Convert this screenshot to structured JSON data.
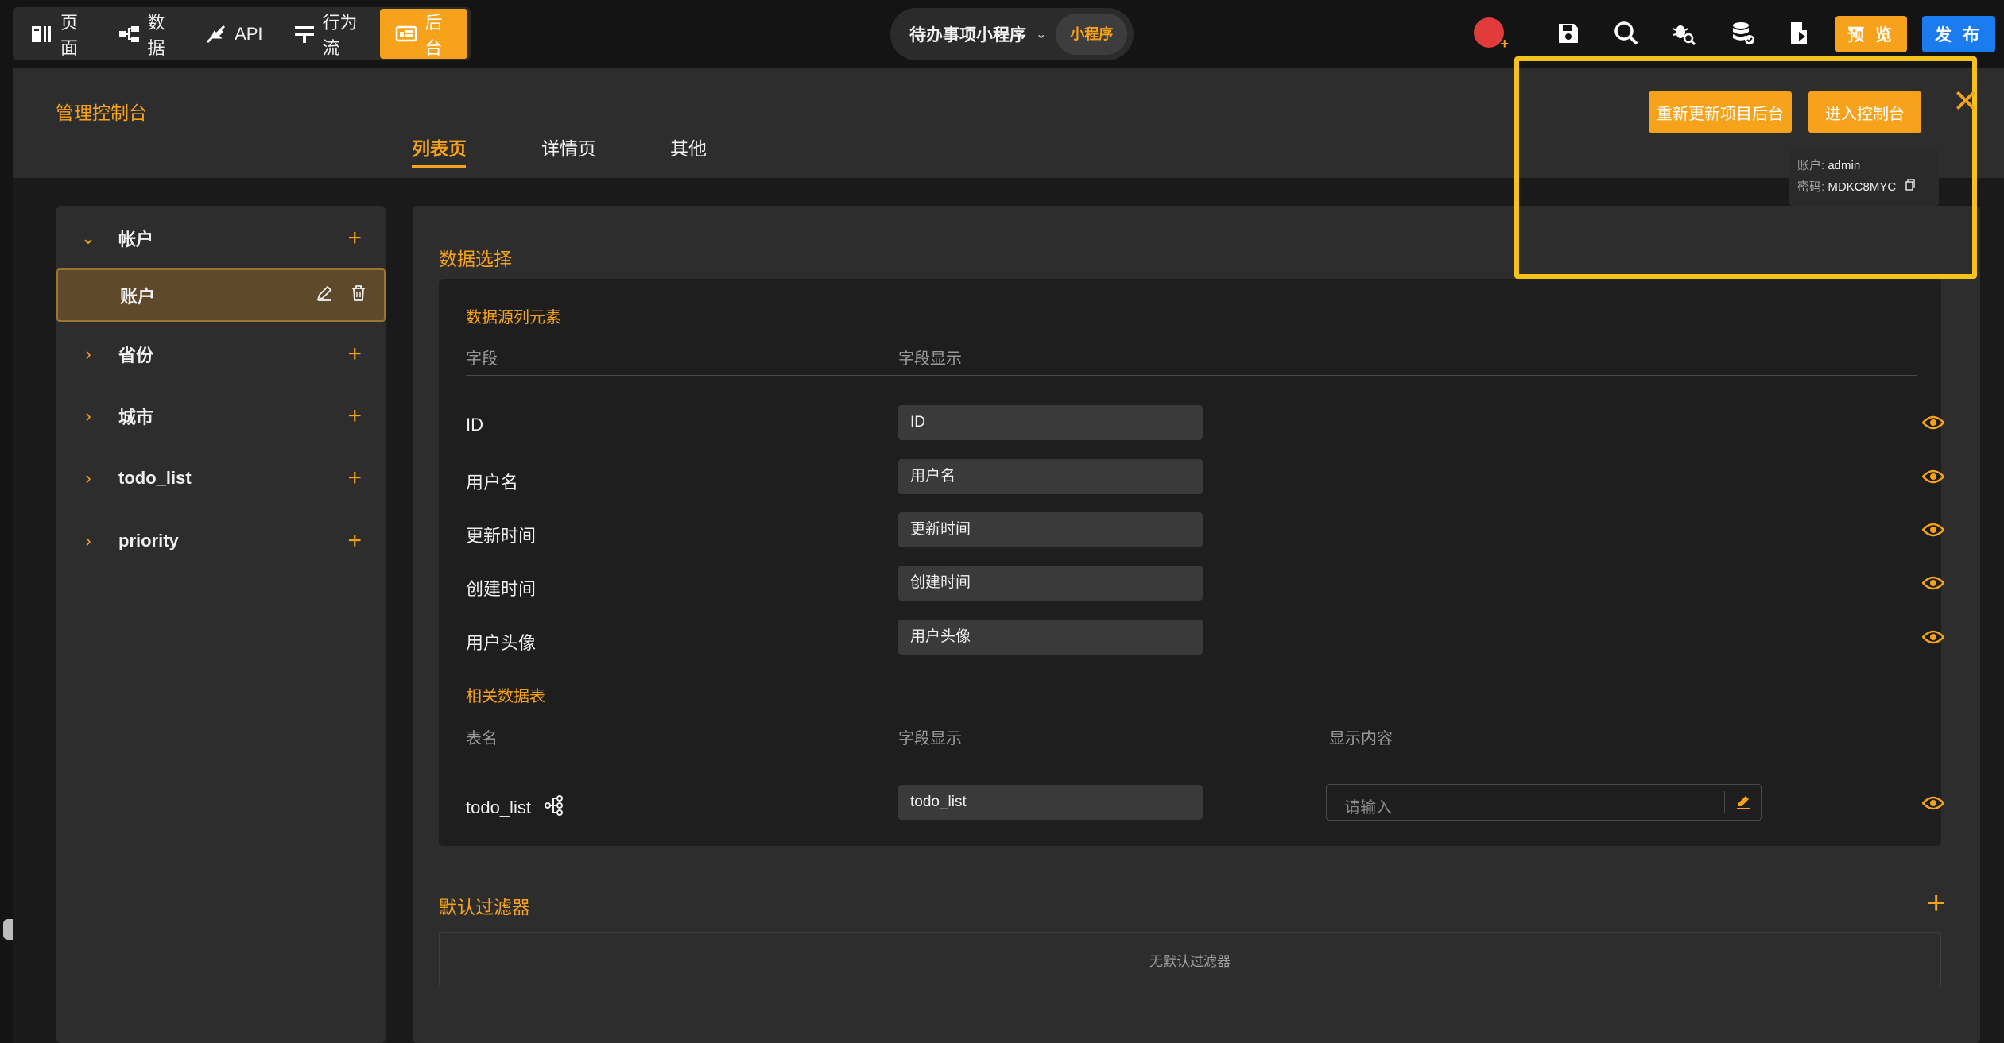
{
  "topnav": {
    "items": [
      {
        "label": "页面",
        "icon": "page-icon"
      },
      {
        "label": "数据",
        "icon": "data-icon"
      },
      {
        "label": "API",
        "icon": "api-icon"
      },
      {
        "label": "行为流",
        "icon": "flow-icon"
      },
      {
        "label": "后台",
        "icon": "backend-icon",
        "active": true
      }
    ]
  },
  "project": {
    "name": "待办事项小程序",
    "tag": "小程序"
  },
  "toolbar": {
    "preview_label": "预 览",
    "publish_label": "发 布"
  },
  "console": {
    "title": "管理控制台"
  },
  "tabs": [
    "列表页",
    "详情页",
    "其他"
  ],
  "sidebar": {
    "items": [
      {
        "label": "帐户",
        "expanded": true
      },
      {
        "label": "账户",
        "selected": true
      },
      {
        "label": "省份"
      },
      {
        "label": "城市"
      },
      {
        "label": "todo_list"
      },
      {
        "label": "priority"
      }
    ]
  },
  "data_select": {
    "title": "数据选择",
    "source_title": "数据源列元素",
    "col_field": "字段",
    "col_display": "字段显示",
    "rows": [
      {
        "field": "ID",
        "display": "ID"
      },
      {
        "field": "用户名",
        "display": "用户名"
      },
      {
        "field": "更新时间",
        "display": "更新时间"
      },
      {
        "field": "创建时间",
        "display": "创建时间"
      },
      {
        "field": "用户头像",
        "display": "用户头像"
      }
    ],
    "related_title": "相关数据表",
    "col_table": "表名",
    "col_display2": "字段显示",
    "col_content": "显示内容",
    "related_row": {
      "table": "todo_list",
      "display": "todo_list",
      "content_placeholder": "请输入"
    }
  },
  "filter": {
    "title": "默认过滤器",
    "empty": "无默认过滤器"
  },
  "popup": {
    "update_label": "重新更新项目后台",
    "enter_label": "进入控制台",
    "account_key": "账户:",
    "account_value": "admin",
    "password_key": "密码:",
    "password_value": "MDKC8MYC"
  },
  "colors": {
    "accent": "#f7a21b",
    "publish": "#1b7cf0",
    "highlight": "#f5c21a"
  }
}
